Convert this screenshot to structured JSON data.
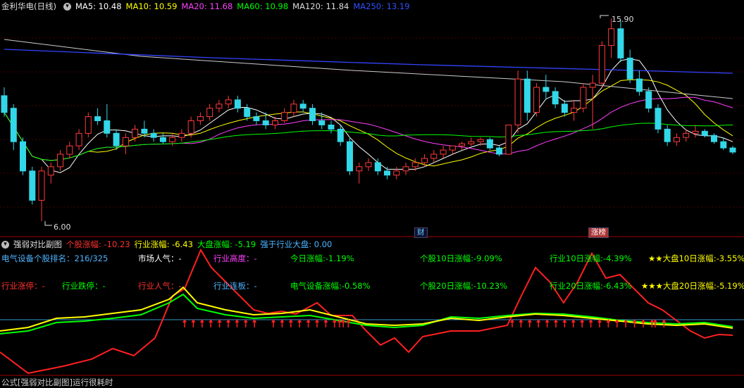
{
  "chart_data": [
    {
      "type": "candlestick",
      "title": "金利华电(日线)",
      "indicators": [
        {
          "label": "MA5: 10.48",
          "color": "#ffffff"
        },
        {
          "label": "MA10: 10.59",
          "color": "#ffff00"
        },
        {
          "label": "MA20: 11.68",
          "color": "#ff00ff"
        },
        {
          "label": "MA60: 10.98",
          "color": "#00ff00"
        },
        {
          "label": "MA120: 11.84",
          "color": "#dddddd"
        },
        {
          "label": "MA250: 13.19",
          "color": "#3333ff"
        }
      ],
      "high_label": "15.90",
      "low_label": "6.00",
      "candles": [
        [
          12.2,
          12.6,
          11.2,
          11.4
        ],
        [
          11.6,
          11.8,
          9.6,
          10.0
        ],
        [
          10.0,
          10.2,
          8.4,
          8.6
        ],
        [
          8.6,
          8.8,
          7.0,
          7.2
        ],
        [
          7.2,
          8.8,
          6.2,
          8.6
        ],
        [
          8.4,
          9.0,
          8.0,
          8.8
        ],
        [
          8.8,
          9.6,
          8.6,
          9.4
        ],
        [
          9.4,
          10.0,
          9.2,
          9.8
        ],
        [
          9.8,
          10.6,
          9.6,
          10.4
        ],
        [
          10.4,
          11.4,
          10.2,
          11.2
        ],
        [
          11.2,
          11.6,
          10.8,
          11.0
        ],
        [
          11.0,
          11.8,
          10.2,
          10.4
        ],
        [
          10.4,
          10.6,
          9.6,
          9.8
        ],
        [
          9.8,
          10.4,
          9.4,
          10.2
        ],
        [
          10.2,
          10.8,
          10.0,
          10.6
        ],
        [
          10.6,
          11.0,
          10.2,
          10.4
        ],
        [
          10.4,
          10.6,
          10.0,
          10.2
        ],
        [
          10.2,
          10.4,
          9.9,
          10.0
        ],
        [
          10.0,
          10.4,
          9.8,
          10.2
        ],
        [
          10.2,
          10.6,
          10.0,
          10.4
        ],
        [
          10.4,
          11.2,
          10.2,
          11.0
        ],
        [
          11.0,
          11.4,
          10.8,
          11.2
        ],
        [
          11.2,
          11.8,
          11.0,
          11.6
        ],
        [
          11.6,
          12.0,
          11.4,
          11.8
        ],
        [
          11.8,
          12.2,
          11.6,
          12.0
        ],
        [
          12.0,
          12.2,
          11.4,
          11.6
        ],
        [
          11.6,
          11.8,
          11.0,
          11.2
        ],
        [
          11.2,
          11.4,
          10.8,
          11.0
        ],
        [
          11.0,
          11.4,
          10.6,
          10.8
        ],
        [
          10.8,
          11.2,
          10.6,
          11.0
        ],
        [
          11.0,
          11.6,
          10.9,
          11.4
        ],
        [
          11.4,
          12.0,
          11.2,
          11.8
        ],
        [
          11.8,
          12.0,
          11.4,
          11.6
        ],
        [
          11.6,
          11.8,
          10.8,
          11.0
        ],
        [
          11.0,
          11.4,
          10.6,
          10.8
        ],
        [
          10.8,
          11.0,
          10.4,
          10.6
        ],
        [
          10.6,
          10.8,
          9.8,
          10.0
        ],
        [
          10.0,
          10.2,
          8.4,
          8.6
        ],
        [
          8.6,
          9.0,
          8.0,
          8.8
        ],
        [
          8.8,
          9.2,
          8.6,
          9.0
        ],
        [
          9.0,
          9.2,
          8.4,
          8.6
        ],
        [
          8.6,
          8.8,
          8.2,
          8.4
        ],
        [
          8.4,
          8.8,
          8.2,
          8.6
        ],
        [
          8.6,
          9.0,
          8.4,
          8.8
        ],
        [
          8.8,
          9.2,
          8.6,
          9.0
        ],
        [
          9.0,
          9.4,
          8.8,
          9.2
        ],
        [
          9.2,
          9.6,
          9.0,
          9.4
        ],
        [
          9.4,
          9.8,
          9.2,
          9.6
        ],
        [
          9.6,
          9.8,
          9.4,
          9.8
        ],
        [
          9.8,
          10.0,
          9.6,
          9.9
        ],
        [
          9.9,
          10.2,
          9.8,
          10.0
        ],
        [
          10.0,
          10.2,
          9.8,
          10.1
        ],
        [
          10.1,
          10.2,
          9.6,
          9.7
        ],
        [
          9.7,
          9.8,
          9.3,
          9.4
        ],
        [
          9.4,
          10.8,
          9.4,
          10.8
        ],
        [
          10.8,
          13.4,
          10.4,
          13.0
        ],
        [
          13.0,
          13.4,
          11.0,
          11.4
        ],
        [
          11.4,
          12.8,
          11.2,
          12.6
        ],
        [
          12.6,
          13.2,
          12.0,
          12.4
        ],
        [
          12.4,
          12.6,
          11.6,
          11.8
        ],
        [
          11.8,
          12.0,
          11.2,
          11.4
        ],
        [
          11.4,
          12.0,
          11.0,
          11.6
        ],
        [
          11.6,
          12.8,
          11.4,
          12.6
        ],
        [
          12.6,
          13.2,
          10.6,
          12.8
        ],
        [
          12.8,
          14.8,
          12.6,
          14.6
        ],
        [
          14.6,
          15.9,
          14.0,
          15.4
        ],
        [
          15.4,
          15.8,
          13.8,
          14.0
        ],
        [
          14.0,
          14.4,
          12.8,
          13.0
        ],
        [
          13.0,
          13.4,
          12.2,
          12.4
        ],
        [
          12.4,
          12.6,
          11.4,
          11.6
        ],
        [
          11.6,
          11.8,
          10.4,
          10.6
        ],
        [
          10.6,
          10.8,
          9.8,
          10.0
        ],
        [
          10.0,
          10.4,
          9.8,
          10.2
        ],
        [
          10.2,
          10.6,
          10.0,
          10.4
        ],
        [
          10.4,
          10.8,
          10.2,
          10.5
        ],
        [
          10.5,
          10.6,
          10.2,
          10.3
        ],
        [
          10.3,
          10.4,
          9.9,
          10.0
        ],
        [
          10.0,
          10.2,
          9.6,
          9.7
        ],
        [
          9.7,
          9.8,
          9.4,
          9.5
        ]
      ]
    },
    {
      "type": "line",
      "title": "强弱对比副图",
      "series": [
        {
          "name": "个股",
          "color": "#ff2020"
        },
        {
          "name": "行业",
          "color": "#ffff00"
        },
        {
          "name": "大盘",
          "color": "#00ff00"
        }
      ]
    }
  ],
  "header": {
    "title": "金利华电(日线)",
    "ma5": "MA5: 10.48",
    "ma10": "MA10: 10.59",
    "ma20": "MA20: 11.68",
    "ma60": "MA60: 10.98",
    "ma120": "MA120: 11.84",
    "ma250": "MA250: 13.19"
  },
  "markers": {
    "high": "15.90",
    "low": "6.00",
    "cai": "财",
    "zhangbang": "涨榜"
  },
  "sub_header": {
    "title": "强弱对比副图",
    "stock": "个股涨幅: -10.23",
    "industry": "行业涨幅: -6.43",
    "market": "大盘涨幅: -5.19",
    "stronger": "强于行业大盘: 0.00"
  },
  "info": {
    "rank": "电气设备个股排名：216/325",
    "mood": "市场人气：-",
    "ind_height": "行业高度：-",
    "today": "今日涨幅:-1.19%",
    "s10": "个股10日涨幅:-9.09%",
    "i10": "行业10日涨幅:-4.39%",
    "m10": "★★大盘10日涨幅:-3.55%",
    "ind_limit_up": "行业涨停：-",
    "ind_limit_down": "行业跌停：-",
    "ind_mood": "行业人气：-",
    "ind_board": "行业连板：-",
    "ind_today": "电气设备涨幅:-0.58%",
    "s20": "个股20日涨幅:-10.23%",
    "i20": "行业20日涨幅:-6.43%",
    "m20": "★★★大盘20日涨幅:-5.19%"
  },
  "footer": "公式[强弱对比副图]运行很耗时"
}
